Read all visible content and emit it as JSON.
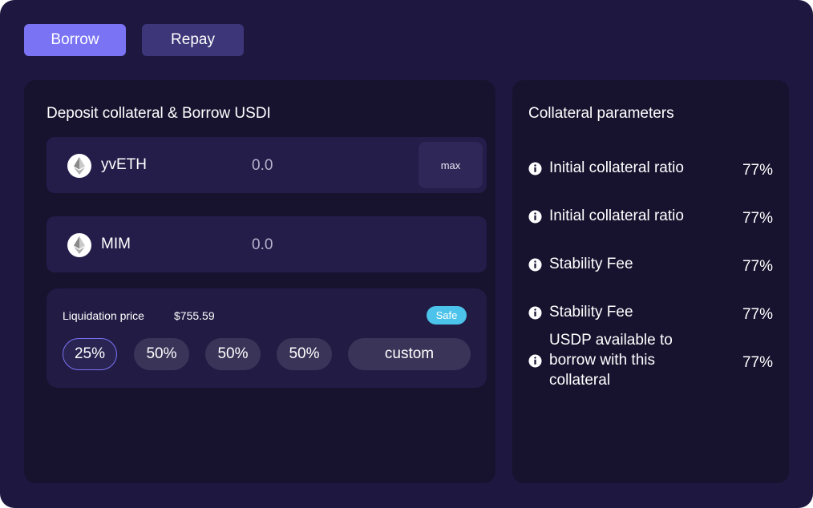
{
  "tabs": {
    "borrow": "Borrow",
    "repay": "Repay"
  },
  "deposit": {
    "title": "Deposit collateral & Borrow USDI",
    "assets": [
      {
        "name": "yvETH",
        "placeholder": "0.0",
        "icon": "eth-coin-icon",
        "max_label": "max"
      },
      {
        "name": "MIM",
        "placeholder": "0.0",
        "icon": "eth-coin-icon"
      }
    ]
  },
  "liquidation": {
    "label": "Liquidation price",
    "value": "$755.59",
    "status": "Safe",
    "options": [
      "25%",
      "50%",
      "50%",
      "50%",
      "custom"
    ],
    "selected_index": 0
  },
  "parameters": {
    "title": "Collateral parameters",
    "items": [
      {
        "label": "Initial collateral ratio",
        "value": "77%",
        "icon": "info-icon"
      },
      {
        "label": "Initial collateral ratio",
        "value": "77%",
        "icon": "info-icon"
      },
      {
        "label": "Stability Fee",
        "value": "77%",
        "icon": "info-icon"
      },
      {
        "label": "Stability Fee",
        "value": "77%",
        "icon": "info-icon"
      },
      {
        "label": "USDP available to borrow with this collateral",
        "value": "77%",
        "icon": "info-icon"
      }
    ]
  },
  "colors": {
    "background": "#1e1841",
    "panel": "#17132f",
    "accent": "#7a73f4",
    "safe": "#4cc3ea"
  }
}
